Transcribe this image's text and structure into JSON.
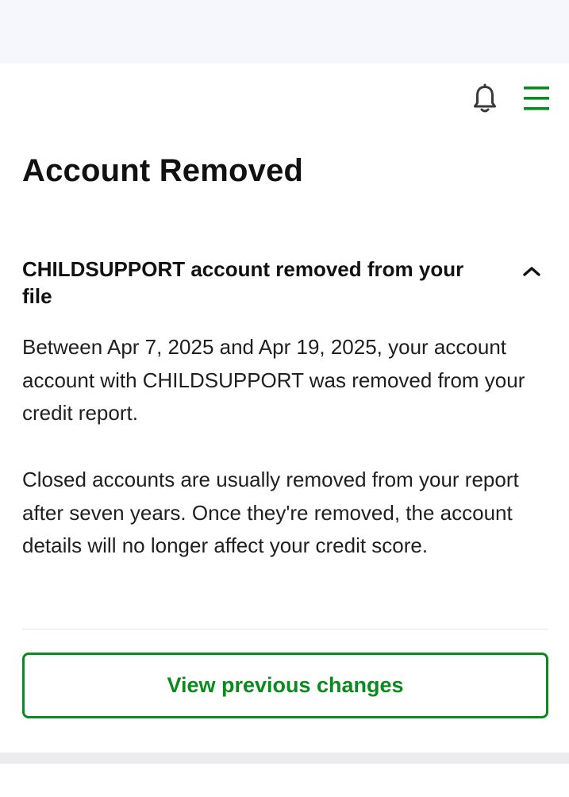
{
  "header": {
    "icons": [
      "bell-icon",
      "menu-icon"
    ],
    "accent_color": "#0a8a1f"
  },
  "page": {
    "title": "Account Removed"
  },
  "accordion": {
    "title": "CHILDSUPPORT account removed from your file",
    "expanded": true,
    "paragraph_1": "Between Apr 7, 2025 and Apr 19, 2025, your account account with CHILDSUPPORT was removed from your credit report.",
    "paragraph_2": "Closed accounts are usually removed from your report after seven years. Once they're removed, the account details will no longer affect your credit score."
  },
  "actions": {
    "view_previous_label": "View previous changes"
  }
}
